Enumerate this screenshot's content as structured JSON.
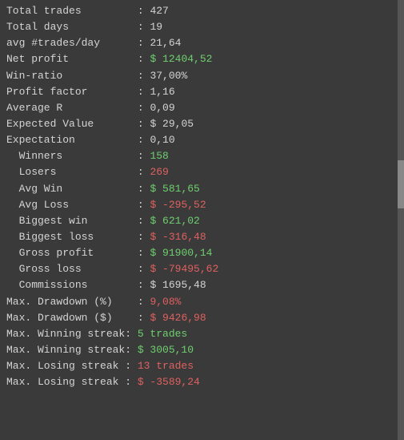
{
  "stats": [
    {
      "label": "Total trades         ",
      "separator": ": ",
      "value": "427",
      "type": "neutral",
      "indent": false
    },
    {
      "label": "Total days           ",
      "separator": ": ",
      "value": "19",
      "type": "neutral",
      "indent": false
    },
    {
      "label": "avg #trades/day      ",
      "separator": ": ",
      "value": "21,64",
      "type": "neutral",
      "indent": false
    },
    {
      "label": "Net profit           ",
      "separator": ": ",
      "value": "$ 12404,52",
      "type": "positive",
      "indent": false
    },
    {
      "label": "Win-ratio            ",
      "separator": ": ",
      "value": "37,00%",
      "type": "neutral",
      "indent": false
    },
    {
      "label": "Profit factor        ",
      "separator": ": ",
      "value": "1,16",
      "type": "neutral",
      "indent": false
    },
    {
      "label": "Average R            ",
      "separator": ": ",
      "value": "0,09",
      "type": "neutral",
      "indent": false
    },
    {
      "label": "Expected Value       ",
      "separator": ": ",
      "value": "$ 29,05",
      "type": "neutral",
      "indent": false
    },
    {
      "label": "Expectation          ",
      "separator": ": ",
      "value": "0,10",
      "type": "neutral",
      "indent": false
    },
    {
      "label": "  Winners            ",
      "separator": ": ",
      "value": "158",
      "type": "positive",
      "indent": true
    },
    {
      "label": "  Losers             ",
      "separator": ": ",
      "value": "269",
      "type": "negative",
      "indent": true
    },
    {
      "label": "  Avg Win            ",
      "separator": ": ",
      "value": "$ 581,65",
      "type": "positive",
      "indent": true
    },
    {
      "label": "  Avg Loss           ",
      "separator": ": ",
      "value": "$ -295,52",
      "type": "negative",
      "indent": true
    },
    {
      "label": "  Biggest win        ",
      "separator": ": ",
      "value": "$ 621,02",
      "type": "positive",
      "indent": true
    },
    {
      "label": "  Biggest loss       ",
      "separator": ": ",
      "value": "$ -316,48",
      "type": "negative",
      "indent": true
    },
    {
      "label": "  Gross profit       ",
      "separator": ": ",
      "value": "$ 91900,14",
      "type": "positive",
      "indent": true
    },
    {
      "label": "  Gross loss         ",
      "separator": ": ",
      "value": "$ -79495,62",
      "type": "negative",
      "indent": true
    },
    {
      "label": "  Commissions        ",
      "separator": ": ",
      "value": "$ 1695,48",
      "type": "neutral",
      "indent": true
    },
    {
      "label": "Max. Drawdown (%)    ",
      "separator": ": ",
      "value": "9,08%",
      "type": "negative",
      "indent": false
    },
    {
      "label": "Max. Drawdown ($)    ",
      "separator": ": ",
      "value": "$ 9426,98",
      "type": "negative",
      "indent": false
    },
    {
      "label": "Max. Winning streak: ",
      "separator": "",
      "value": "5 trades",
      "type": "positive",
      "indent": false
    },
    {
      "label": "Max. Winning streak: ",
      "separator": "",
      "value": "$ 3005,10",
      "type": "positive",
      "indent": false
    },
    {
      "label": "Max. Losing streak : ",
      "separator": "",
      "value": "13 trades",
      "type": "negative",
      "indent": false
    },
    {
      "label": "Max. Losing streak : ",
      "separator": "",
      "value": "$ -3589,24",
      "type": "negative",
      "indent": false
    }
  ]
}
